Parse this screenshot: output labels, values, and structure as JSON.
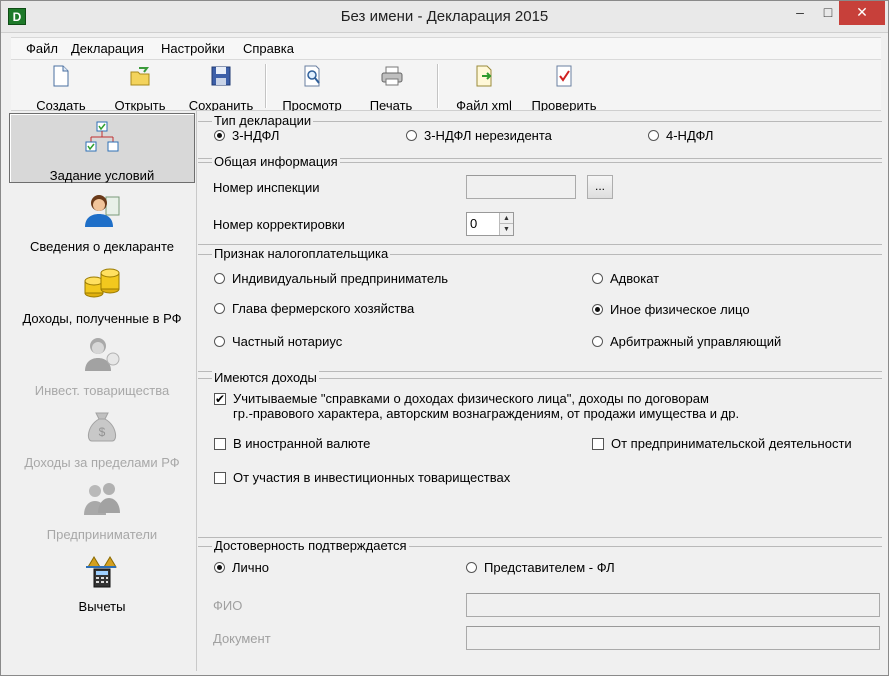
{
  "window": {
    "title": "Без имени - Декларация 2015",
    "app_icon": "D",
    "minimize": "–",
    "maximize": "□",
    "close": "✕"
  },
  "menu": [
    "Файл",
    "Декларация",
    "Настройки",
    "Справка"
  ],
  "toolbar": {
    "create": "Создать",
    "open": "Открыть",
    "save": "Сохранить",
    "preview": "Просмотр",
    "print": "Печать",
    "xml": "Файл xml",
    "check": "Проверить"
  },
  "sidebar": {
    "items": [
      {
        "label": "Задание условий",
        "icon": "conditions-tree-icon",
        "active": true,
        "enabled": true
      },
      {
        "label": "Сведения о декларанте",
        "icon": "person-document-icon",
        "active": false,
        "enabled": true
      },
      {
        "label": "Доходы, полученные в РФ",
        "icon": "coins-icon",
        "active": false,
        "enabled": true
      },
      {
        "label": "Инвест. товарищества",
        "icon": "investor-icon",
        "active": false,
        "enabled": false
      },
      {
        "label": "Доходы за пределами РФ",
        "icon": "money-bag-icon",
        "active": false,
        "enabled": false
      },
      {
        "label": "Предприниматели",
        "icon": "entrepreneurs-icon",
        "active": false,
        "enabled": false
      },
      {
        "label": "Вычеты",
        "icon": "calculator-icon",
        "active": false,
        "enabled": true
      }
    ]
  },
  "declaration_type": {
    "title": "Тип декларации",
    "options": [
      {
        "label": "3-НДФЛ",
        "selected": true
      },
      {
        "label": "3-НДФЛ нерезидента",
        "selected": false
      },
      {
        "label": "4-НДФЛ",
        "selected": false
      }
    ]
  },
  "general_info": {
    "title": "Общая информация",
    "inspection_label": "Номер инспекции",
    "inspection_value": "",
    "browse_button": "...",
    "correction_label": "Номер корректировки",
    "correction_value": "0",
    "spin_up": "▲",
    "spin_down": "▼"
  },
  "taxpayer_sign": {
    "title": "Признак налогоплательщика",
    "options": [
      {
        "label": "Индивидуальный предприниматель",
        "selected": false
      },
      {
        "label": "Адвокат",
        "selected": false
      },
      {
        "label": "Глава фермерского хозяйства",
        "selected": false
      },
      {
        "label": "Иное физическое лицо",
        "selected": true
      },
      {
        "label": "Частный нотариус",
        "selected": false
      },
      {
        "label": "Арбитражный управляющий",
        "selected": false
      }
    ]
  },
  "incomes": {
    "title": "Имеются доходы",
    "checks": [
      {
        "label": "Учитываемые \"справками о доходах физического лица\", доходы по договорам",
        "label2": "гр.-правового характера, авторским вознаграждениям, от продажи имущества и др.",
        "checked": true
      },
      {
        "label": "В иностранной валюте",
        "checked": false
      },
      {
        "label": "От предпринимательской деятельности",
        "checked": false
      },
      {
        "label": "От участия в инвестиционных товариществах",
        "checked": false
      }
    ],
    "check_mark": "✔"
  },
  "confirmation": {
    "title": "Достоверность подтверждается",
    "options": [
      {
        "label": "Лично",
        "selected": true
      },
      {
        "label": "Представителем - ФЛ",
        "selected": false
      }
    ],
    "fio_label": "ФИО",
    "fio_value": "",
    "document_label": "Документ",
    "document_value": ""
  }
}
